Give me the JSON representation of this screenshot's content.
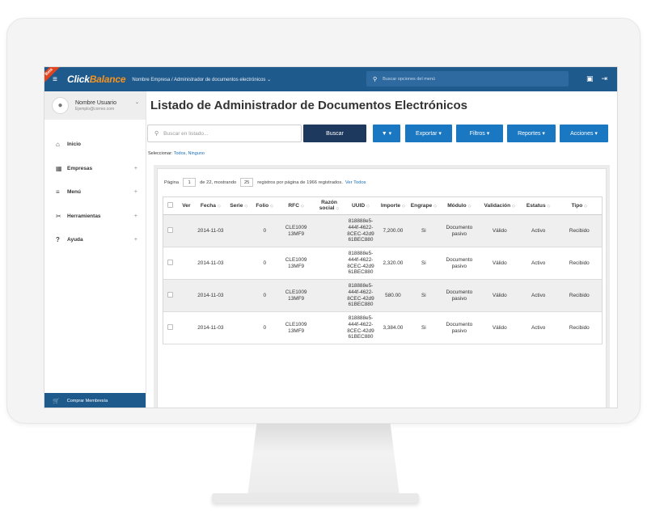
{
  "app": {
    "ribbon": "Beta",
    "logo_part1": "Click",
    "logo_part2": "Balance",
    "breadcrumb": "Nombre Empresa / Administrador de documentos electrónicos ⌄",
    "top_search_placeholder": "Buscar opciones del menú"
  },
  "user": {
    "name": "Nombre Usuario",
    "email": "Ejemplo@correo.com"
  },
  "sidebar": {
    "items": [
      {
        "label": "Inicio",
        "icon": "home-icon",
        "glyph": "⌂"
      },
      {
        "label": "Empresas",
        "icon": "building-icon",
        "glyph": "▦"
      },
      {
        "label": "Menú",
        "icon": "list-icon",
        "glyph": "≡"
      },
      {
        "label": "Herramientas",
        "icon": "tools-icon",
        "glyph": "✂"
      },
      {
        "label": "Ayuda",
        "icon": "question-icon",
        "glyph": "?"
      }
    ],
    "buy_label": "Comprar Membresía"
  },
  "main": {
    "title": "Listado de Administrador de Documentos Electrónicos",
    "search_placeholder": "Buscar en listado...",
    "buscar_label": "Buscar",
    "filter_label": "▼ ▾",
    "exportar_label": "Exportar ▾",
    "filtros_label": "Filtros ▾",
    "reportes_label": "Reportes ▾",
    "acciones_label": "Acciones ▾",
    "select_prefix": "Seleccionar:",
    "select_all": "Todos,",
    "select_none": "Ninguno"
  },
  "pager": {
    "page_label": "Página",
    "page_value": "1",
    "of_label": "de 22, mostrando",
    "per_page_value": "25",
    "suffix": "registros por página de 1966 registrados.",
    "view_all": "Ver Todos"
  },
  "table": {
    "headers": [
      "Ver",
      "Fecha",
      "Serie",
      "Folio",
      "RFC",
      "Razón social",
      "UUID",
      "Importe",
      "Engrape",
      "Módulo",
      "Validación",
      "Estatus",
      "Tipo"
    ],
    "rows": [
      {
        "fecha": "2014-11-03",
        "serie": "",
        "folio": "0",
        "rfc": "CLE1009 13MF9",
        "razon": "",
        "uuid": "818888e5-444f-4622-8CEC-42d9 61BEC880",
        "importe": "7,200.00",
        "engrape": "Si",
        "modulo": "Documento pasivo",
        "validacion": "Válido",
        "estatus": "Activo",
        "tipo": "Recibido"
      },
      {
        "fecha": "2014-11-03",
        "serie": "",
        "folio": "0",
        "rfc": "CLE1009 13MF9",
        "razon": "",
        "uuid": "818888e5-444f-4622-8CEC-42d9 61BEC880",
        "importe": "2,320.00",
        "engrape": "Si",
        "modulo": "Documento pasivo",
        "validacion": "Válido",
        "estatus": "Activo",
        "tipo": "Recibido"
      },
      {
        "fecha": "2014-11-03",
        "serie": "",
        "folio": "0",
        "rfc": "CLE1009 13MF9",
        "razon": "",
        "uuid": "818888e5-444f-4622-8CEC-42d9 61BEC880",
        "importe": "580.00",
        "engrape": "Si",
        "modulo": "Documento pasivo",
        "validacion": "Válido",
        "estatus": "Activo",
        "tipo": "Recibido"
      },
      {
        "fecha": "2014-11-03",
        "serie": "",
        "folio": "0",
        "rfc": "CLE1009 13MF9",
        "razon": "",
        "uuid": "818888e5-444f-4622-8CEC-42d9 61BEC880",
        "importe": "3,384.00",
        "engrape": "Si",
        "modulo": "Documento pasivo",
        "validacion": "Válido",
        "estatus": "Activo",
        "tipo": "Recibido"
      }
    ]
  },
  "colors": {
    "topbar": "#1f5a8c",
    "accent_orange": "#f7931e",
    "button_dark": "#1d3a5e",
    "button_blue": "#1a78c2",
    "valid_green": "#2e8b2e"
  }
}
